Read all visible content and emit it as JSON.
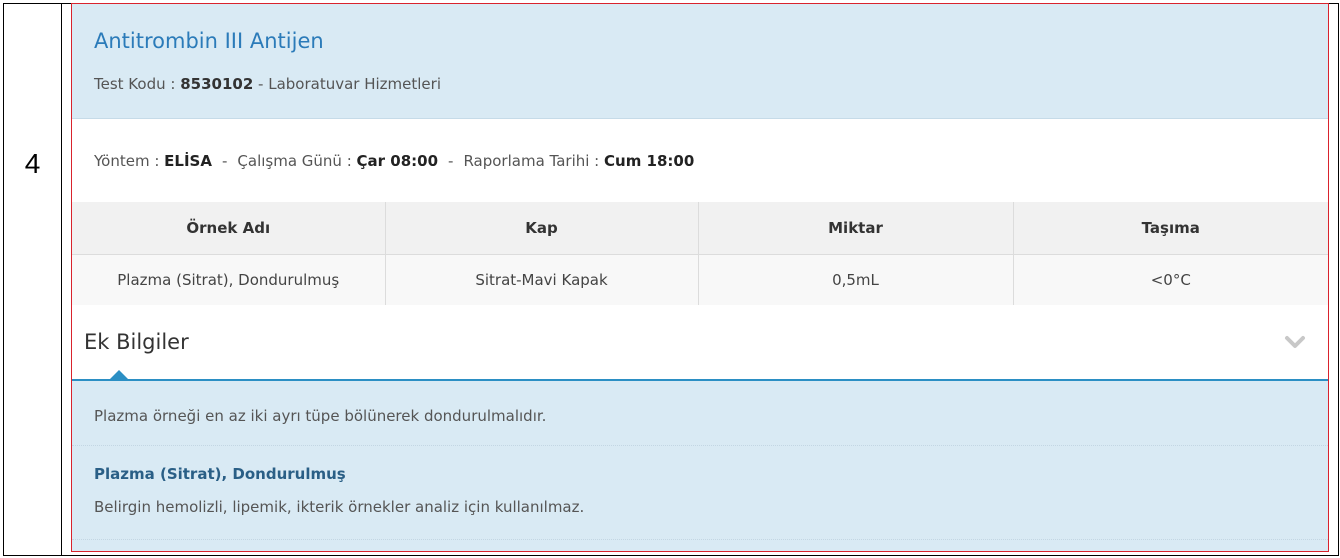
{
  "row_number": "4",
  "test": {
    "name": "Antitrombin III Antijen",
    "code_label": "Test Kodu : ",
    "code": "8530102",
    "code_suffix": " - Laboratuvar Hizmetleri"
  },
  "method": {
    "method_label": "Yöntem : ",
    "method_value": "ELİSA",
    "sep": "-",
    "day_label": "Çalışma Günü : ",
    "day_value": "Çar 08:00",
    "report_label": "Raporlama Tarihi : ",
    "report_value": "Cum 18:00"
  },
  "specimen_table": {
    "headers": [
      "Örnek Adı",
      "Kap",
      "Miktar",
      "Taşıma"
    ],
    "rows": [
      [
        "Plazma (Sitrat), Dondurulmuş",
        "Sitrat-Mavi Kapak",
        "0,5mL",
        "<0°C"
      ]
    ]
  },
  "additional_info": {
    "title": "Ek Bilgiler",
    "toggle_icon": "chevron-down-icon",
    "note": "Plazma örneği en az iki ayrı tüpe bölünerek dondurulmalıdır.",
    "specimen_title": "Plazma (Sitrat), Dondurulmuş",
    "specimen_note": "Belirgin hemolizli, lipemik, ikterik örnekler analiz için kullanılmaz."
  },
  "colors": {
    "accent": "#2b7bb9",
    "header_bg": "#d9eaf4",
    "highlight_border": "#d9232d"
  }
}
